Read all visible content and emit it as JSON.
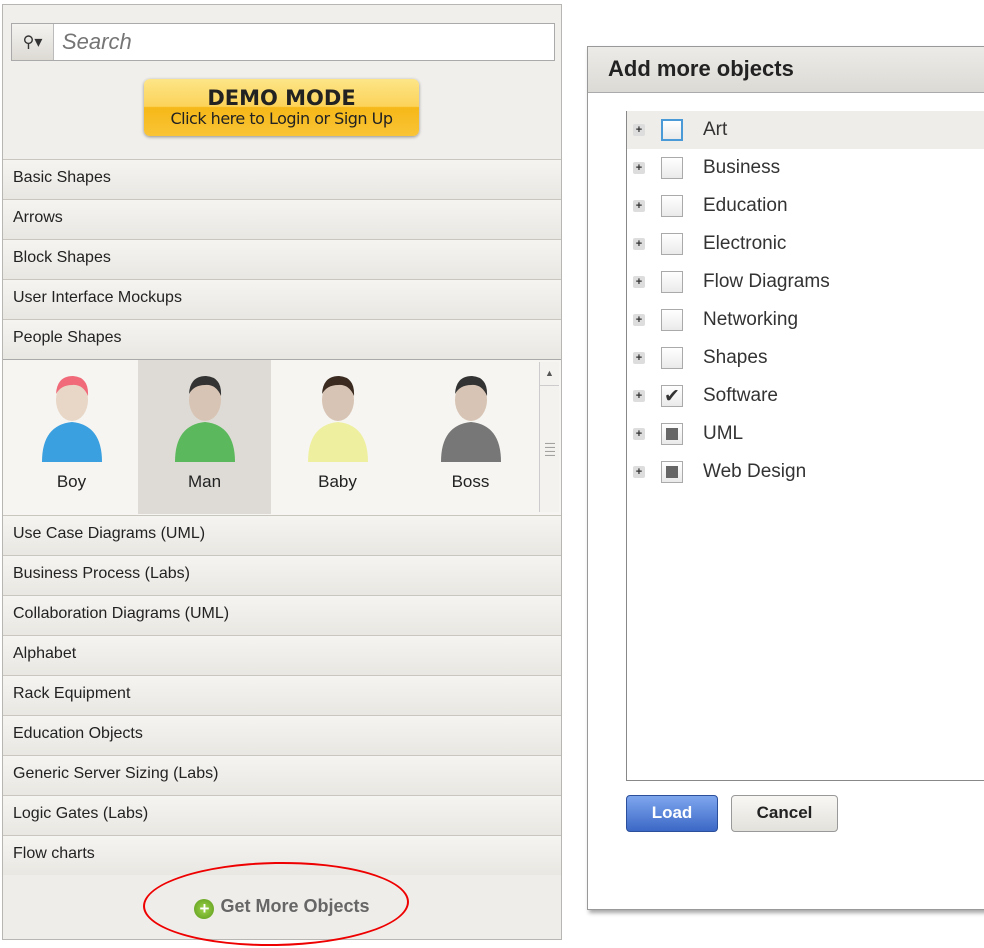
{
  "search": {
    "placeholder": "Search",
    "icon": "search-dropdown-icon"
  },
  "demo": {
    "title": "DEMO MODE",
    "subtitle": "Click here to Login or Sign Up"
  },
  "categories_top": [
    "Basic Shapes",
    "Arrows",
    "Block Shapes",
    "User Interface Mockups",
    "People Shapes"
  ],
  "people": [
    {
      "label": "Boy"
    },
    {
      "label": "Man",
      "selected": true
    },
    {
      "label": "Baby"
    },
    {
      "label": "Boss"
    }
  ],
  "categories_bottom": [
    "Use Case Diagrams (UML)",
    "Business Process (Labs)",
    "Collaboration Diagrams (UML)",
    "Alphabet",
    "Rack Equipment",
    "Education Objects",
    "Generic Server Sizing (Labs)",
    "Logic Gates (Labs)",
    "Flow charts"
  ],
  "get_more": "Get More Objects",
  "dialog": {
    "title": "Add more objects",
    "items": [
      {
        "label": "Art",
        "state": "unchecked"
      },
      {
        "label": "Business",
        "state": "unchecked"
      },
      {
        "label": "Education",
        "state": "unchecked"
      },
      {
        "label": "Electronic",
        "state": "unchecked"
      },
      {
        "label": "Flow Diagrams",
        "state": "unchecked"
      },
      {
        "label": "Networking",
        "state": "unchecked"
      },
      {
        "label": "Shapes",
        "state": "unchecked"
      },
      {
        "label": "Software",
        "state": "checked"
      },
      {
        "label": "UML",
        "state": "partial"
      },
      {
        "label": "Web Design",
        "state": "partial"
      }
    ],
    "load": "Load",
    "cancel": "Cancel"
  },
  "colors": {
    "accent": "#3c68c6",
    "annotation": "#e00000"
  }
}
